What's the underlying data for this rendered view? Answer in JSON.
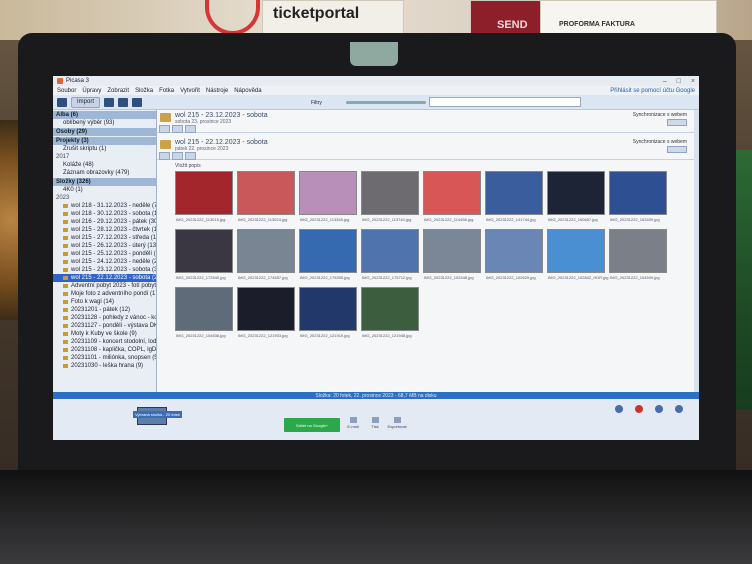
{
  "room": {
    "poster_brand": "ticketportal",
    "poster_red_text": "SEND",
    "poster_proforma": "PROFORMA FAKTURA"
  },
  "window": {
    "title": "Picasa 3",
    "controls": [
      "–",
      "□",
      "×"
    ]
  },
  "menu": {
    "items": [
      "Soubor",
      "Úpravy",
      "Zobrazit",
      "Složka",
      "Fotka",
      "Vytvořit",
      "Nástroje",
      "Nápověda"
    ],
    "account_link": "Přihlásit se pomocí účtu Google"
  },
  "toolbar": {
    "import_label": "Import",
    "filter_label": "Filtry"
  },
  "sidebar": {
    "sections": [
      {
        "title": "Alba (6)",
        "items": [
          "oblíbený výběr (93)"
        ]
      },
      {
        "title": "Osoby (29)",
        "items": []
      },
      {
        "title": "Projekty (3)",
        "items": [
          "Zrušit skriptu (1)"
        ]
      }
    ],
    "year_2017": "2017",
    "items_2017": [
      "Koláže (48)",
      "Záznam obrazovky (479)"
    ],
    "folders_title": "Složky (326)",
    "folders_top": [
      "4K0 (1)"
    ],
    "year_2023": "2023",
    "folders_2023": [
      "wol 218 - 31.12.2023 - neděle (73)",
      "wol 218 - 30.12.2023 - sobota (12)",
      "wol 216 - 29.12.2023 - pátek (30)",
      "wol 215 - 28.12.2023 - čtvrtek (16)",
      "wol 215 - 27.12.2023 - středa (11)",
      "wol 215 - 26.12.2023 - úterý (13)",
      "wol 215 - 25.12.2023 - pondělí (24)",
      "wol 215 - 24.12.2023 - neděle (24)",
      "wol 215 - 23.12.2023 - sobota (35)",
      "wol 215 - 22.12.2023 - sobota (20)",
      "Adventní pobyt 2023 - fotí pobytů",
      "Moje foto z adventního pondí (17)",
      "Foto k wagi (14)",
      "20231201 - pátek (12)",
      "20231128 - pohledy z vánoc - kočk (6)",
      "20231127 - pondělí - výstava DK (37)",
      "Moty k Kuby ve škole (9)",
      "20231109 - koncert stodolní, loď a tr",
      "20231108 - kaplička, COPL, lgD (1)",
      "20231101 - miliónka, snopsen (5)",
      "20231030 - leška hrana (9)"
    ],
    "selected_index": 9
  },
  "folders": [
    {
      "title": "wol 215 - 23.12.2023 - sobota",
      "subtitle": "sobota 23. prosince 2023",
      "sync_label": "Synchronizace s webem",
      "share_label": "Sdílet"
    },
    {
      "title": "wol 215 - 22.12.2023 - sobota",
      "subtitle": "pátek 22. prosince 2023",
      "sync_label": "Synchronizace s webem",
      "share_label": "Sdílet"
    }
  ],
  "photos_label": "Vložit popis",
  "thumbnails": [
    {
      "caption": "IMG_20231222_113015.jpg",
      "color": "#a3262d"
    },
    {
      "caption": "IMG_20231222_113024.jpg",
      "color": "#c9585a"
    },
    {
      "caption": "IMG_20231222_113345.jpg",
      "color": "#b88fb8"
    },
    {
      "caption": "IMG_20231222_113744.jpg",
      "color": "#6d6a70"
    },
    {
      "caption": "IMG_20231222_114458.jpg",
      "color": "#d85656"
    },
    {
      "caption": "IMG_20231222_141744.jpg",
      "color": "#3a5d9e"
    },
    {
      "caption": "IMG_20231222_160657.jpg",
      "color": "#1d2436"
    },
    {
      "caption": "IMG_20231222_163409.jpg",
      "color": "#2f4f93"
    },
    {
      "caption": "IMG_20231222_172540.jpg",
      "color": "#3a3742"
    },
    {
      "caption": "IMG_20231222_174657.jpg",
      "color": "#7a8594"
    },
    {
      "caption": "IMG_20231222_175300.jpg",
      "color": "#3569b0"
    },
    {
      "caption": "IMG_20231222_175712.jpg",
      "color": "#4f73ad"
    },
    {
      "caption": "IMG_20231222_102448.jpg",
      "color": "#7b8697"
    },
    {
      "caption": "IMG_20231222_102629.jpg",
      "color": "#6a86b5"
    },
    {
      "caption": "IMG_20231222_102842_HDR.jpg",
      "color": "#4a8fd1"
    },
    {
      "caption": "IMG_20231222_104509.jpg",
      "color": "#7a7f88"
    },
    {
      "caption": "IMG_20231222_104838.jpg",
      "color": "#5f6b78"
    },
    {
      "caption": "IMG_20231222_121903.jpg",
      "color": "#1b1e2a"
    },
    {
      "caption": "IMG_20231222_121919.jpg",
      "color": "#22386b"
    },
    {
      "caption": "IMG_20231222_121948.jpg",
      "color": "#3d5d3f"
    }
  ],
  "status_text": "Složka: 20 fotek, 22. prosince 2023 - 68,7 MB na disku",
  "tray": {
    "selection_label": "Vybraná složka - 20 fotek",
    "gplus_label": "Sdílet na Google+",
    "actions": [
      "E-mail",
      "Tisk",
      "Exportovat"
    ]
  }
}
